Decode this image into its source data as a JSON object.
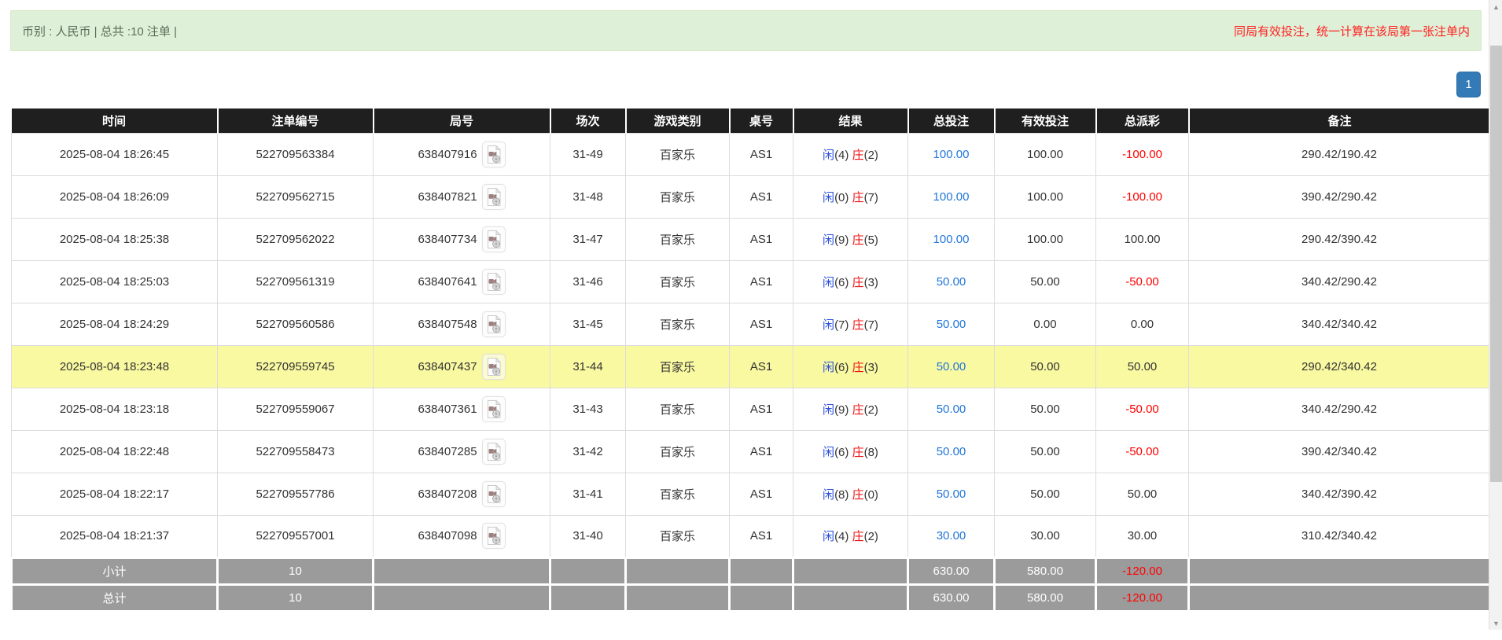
{
  "colors": {
    "header_bg": "#1f1f1f",
    "highlight": "#f9f9a2",
    "player_blue": "#2a50dd",
    "banker_red": "#ee1111",
    "link_blue": "#2176d9",
    "negative_red": "#ff0000",
    "footer_gray": "#9b9b9b",
    "banner_bg": "#dff0d8",
    "banner_text": "#5a6e5a",
    "notice_red": "#ff1f1f",
    "pagination_blue": "#337ab7"
  },
  "banner": {
    "left_text": "币别 : 人民币 | 总共 :10 注单 |",
    "right_text": "同局有效投注，统一计算在该局第一张注单内"
  },
  "pagination": {
    "current_page": "1"
  },
  "icons": {
    "video_icon": "video-file-icon",
    "scroll_up": "▲",
    "scroll_down": "▼"
  },
  "table": {
    "headers": [
      "时间",
      "注单编号",
      "局号",
      "场次",
      "游戏类别",
      "桌号",
      "结果",
      "总投注",
      "有效投注",
      "总派彩",
      "备注"
    ],
    "rows": [
      {
        "time": "2025-08-04 18:26:45",
        "bet_id": "522709563384",
        "round_no": "638407916",
        "session": "31-49",
        "game_type": "百家乐",
        "table_no": "AS1",
        "result": {
          "player_label": "闲",
          "player_points": "(4)",
          "banker_label": "庄",
          "banker_points": "(2)"
        },
        "total_bet": "100.00",
        "valid_bet": "100.00",
        "total_payout": "-100.00",
        "remark": "290.42/190.42",
        "highlight": false
      },
      {
        "time": "2025-08-04 18:26:09",
        "bet_id": "522709562715",
        "round_no": "638407821",
        "session": "31-48",
        "game_type": "百家乐",
        "table_no": "AS1",
        "result": {
          "player_label": "闲",
          "player_points": "(0)",
          "banker_label": "庄",
          "banker_points": "(7)"
        },
        "total_bet": "100.00",
        "valid_bet": "100.00",
        "total_payout": "-100.00",
        "remark": "390.42/290.42",
        "highlight": false
      },
      {
        "time": "2025-08-04 18:25:38",
        "bet_id": "522709562022",
        "round_no": "638407734",
        "session": "31-47",
        "game_type": "百家乐",
        "table_no": "AS1",
        "result": {
          "player_label": "闲",
          "player_points": "(9)",
          "banker_label": "庄",
          "banker_points": "(5)"
        },
        "total_bet": "100.00",
        "valid_bet": "100.00",
        "total_payout": "100.00",
        "remark": "290.42/390.42",
        "highlight": false
      },
      {
        "time": "2025-08-04 18:25:03",
        "bet_id": "522709561319",
        "round_no": "638407641",
        "session": "31-46",
        "game_type": "百家乐",
        "table_no": "AS1",
        "result": {
          "player_label": "闲",
          "player_points": "(6)",
          "banker_label": "庄",
          "banker_points": "(3)"
        },
        "total_bet": "50.00",
        "valid_bet": "50.00",
        "total_payout": "-50.00",
        "remark": "340.42/290.42",
        "highlight": false
      },
      {
        "time": "2025-08-04 18:24:29",
        "bet_id": "522709560586",
        "round_no": "638407548",
        "session": "31-45",
        "game_type": "百家乐",
        "table_no": "AS1",
        "result": {
          "player_label": "闲",
          "player_points": "(7)",
          "banker_label": "庄",
          "banker_points": "(7)"
        },
        "total_bet": "50.00",
        "valid_bet": "0.00",
        "total_payout": "0.00",
        "remark": "340.42/340.42",
        "highlight": false
      },
      {
        "time": "2025-08-04 18:23:48",
        "bet_id": "522709559745",
        "round_no": "638407437",
        "session": "31-44",
        "game_type": "百家乐",
        "table_no": "AS1",
        "result": {
          "player_label": "闲",
          "player_points": "(6)",
          "banker_label": "庄",
          "banker_points": "(3)"
        },
        "total_bet": "50.00",
        "valid_bet": "50.00",
        "total_payout": "50.00",
        "remark": "290.42/340.42",
        "highlight": true
      },
      {
        "time": "2025-08-04 18:23:18",
        "bet_id": "522709559067",
        "round_no": "638407361",
        "session": "31-43",
        "game_type": "百家乐",
        "table_no": "AS1",
        "result": {
          "player_label": "闲",
          "player_points": "(9)",
          "banker_label": "庄",
          "banker_points": "(2)"
        },
        "total_bet": "50.00",
        "valid_bet": "50.00",
        "total_payout": "-50.00",
        "remark": "340.42/290.42",
        "highlight": false
      },
      {
        "time": "2025-08-04 18:22:48",
        "bet_id": "522709558473",
        "round_no": "638407285",
        "session": "31-42",
        "game_type": "百家乐",
        "table_no": "AS1",
        "result": {
          "player_label": "闲",
          "player_points": "(6)",
          "banker_label": "庄",
          "banker_points": "(8)"
        },
        "total_bet": "50.00",
        "valid_bet": "50.00",
        "total_payout": "-50.00",
        "remark": "390.42/340.42",
        "highlight": false
      },
      {
        "time": "2025-08-04 18:22:17",
        "bet_id": "522709557786",
        "round_no": "638407208",
        "session": "31-41",
        "game_type": "百家乐",
        "table_no": "AS1",
        "result": {
          "player_label": "闲",
          "player_points": "(8)",
          "banker_label": "庄",
          "banker_points": "(0)"
        },
        "total_bet": "50.00",
        "valid_bet": "50.00",
        "total_payout": "50.00",
        "remark": "340.42/390.42",
        "highlight": false
      },
      {
        "time": "2025-08-04 18:21:37",
        "bet_id": "522709557001",
        "round_no": "638407098",
        "session": "31-40",
        "game_type": "百家乐",
        "table_no": "AS1",
        "result": {
          "player_label": "闲",
          "player_points": "(4)",
          "banker_label": "庄",
          "banker_points": "(2)"
        },
        "total_bet": "30.00",
        "valid_bet": "30.00",
        "total_payout": "30.00",
        "remark": "310.42/340.42",
        "highlight": false
      }
    ],
    "subtotal": {
      "label": "小计",
      "count": "10",
      "total_bet": "630.00",
      "valid_bet": "580.00",
      "total_payout": "-120.00"
    },
    "total": {
      "label": "总计",
      "count": "10",
      "total_bet": "630.00",
      "valid_bet": "580.00",
      "total_payout": "-120.00"
    }
  }
}
